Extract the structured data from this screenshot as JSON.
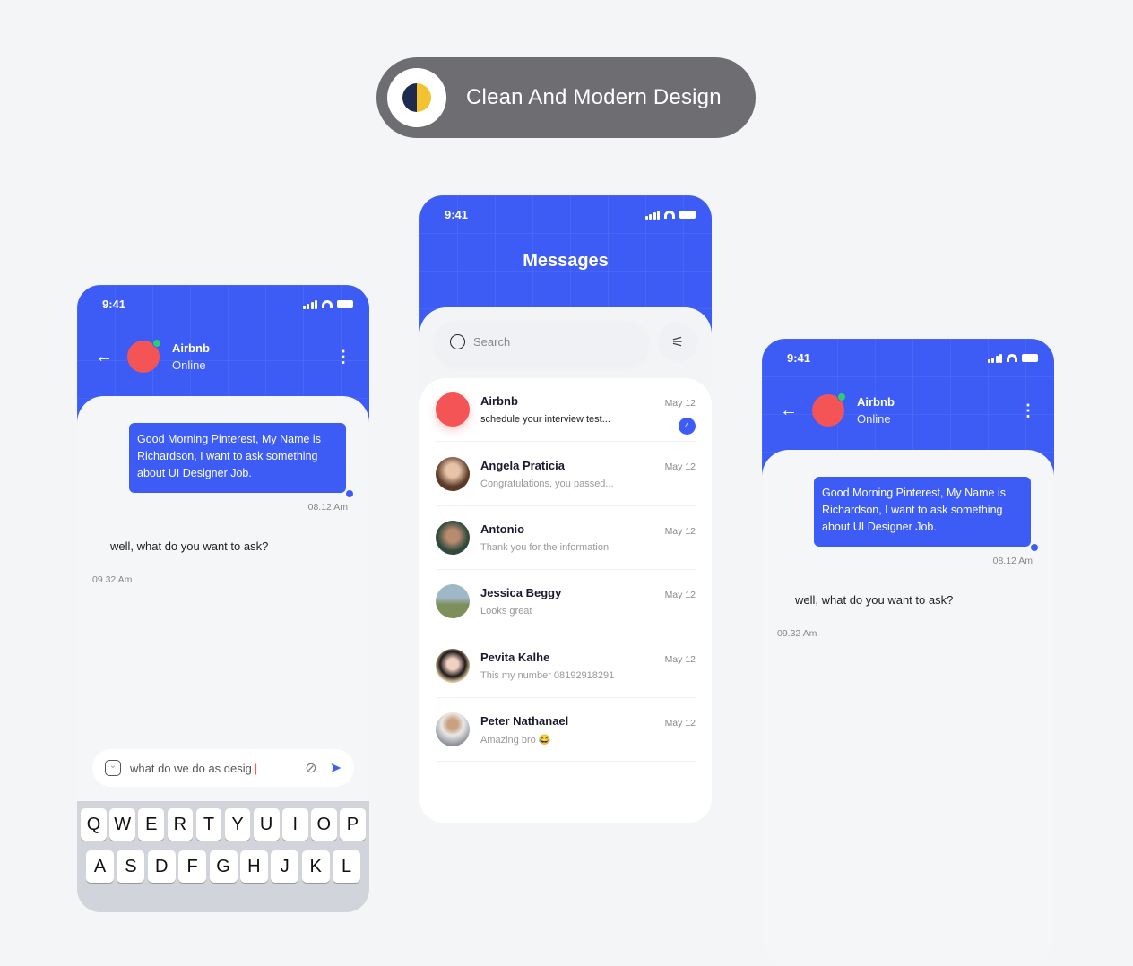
{
  "banner": {
    "label": "Clean And Modern Design",
    "logo": "moon-icon"
  },
  "status": {
    "time": "9:41"
  },
  "chat": {
    "contact_name": "Airbnb",
    "contact_status": "Online",
    "sent_message": "Good Morning Pinterest, My Name is Richardson, I want to ask something about UI Designer Job.",
    "sent_time": "08.12 Am",
    "received_message": "well, what do you want to ask?",
    "received_time": "09.32 Am",
    "input_value": "what do we do as desig",
    "keyboard": {
      "row1": [
        "Q",
        "W",
        "E",
        "R",
        "T",
        "Y",
        "U",
        "I",
        "O",
        "P"
      ],
      "row2": [
        "A",
        "S",
        "D",
        "F",
        "G",
        "H",
        "J",
        "K",
        "L"
      ]
    }
  },
  "messages": {
    "title": "Messages",
    "search_placeholder": "Search",
    "accent": "#3D5CF5",
    "items": [
      {
        "name": "Airbnb",
        "preview": "schedule your interview test...",
        "date": "May 12",
        "unread": "4"
      },
      {
        "name": "Angela Praticia",
        "preview": "Congratulations, you passed...",
        "date": "May 12"
      },
      {
        "name": "Antonio",
        "preview": "Thank you for the information",
        "date": "May 12"
      },
      {
        "name": "Jessica Beggy",
        "preview": "Looks great",
        "date": "May 12"
      },
      {
        "name": "Pevita Kalhe",
        "preview": "This my number 08192918291",
        "date": "May 12"
      },
      {
        "name": "Peter Nathanael",
        "preview": "Amazing bro 😂",
        "date": "May 12"
      }
    ]
  }
}
